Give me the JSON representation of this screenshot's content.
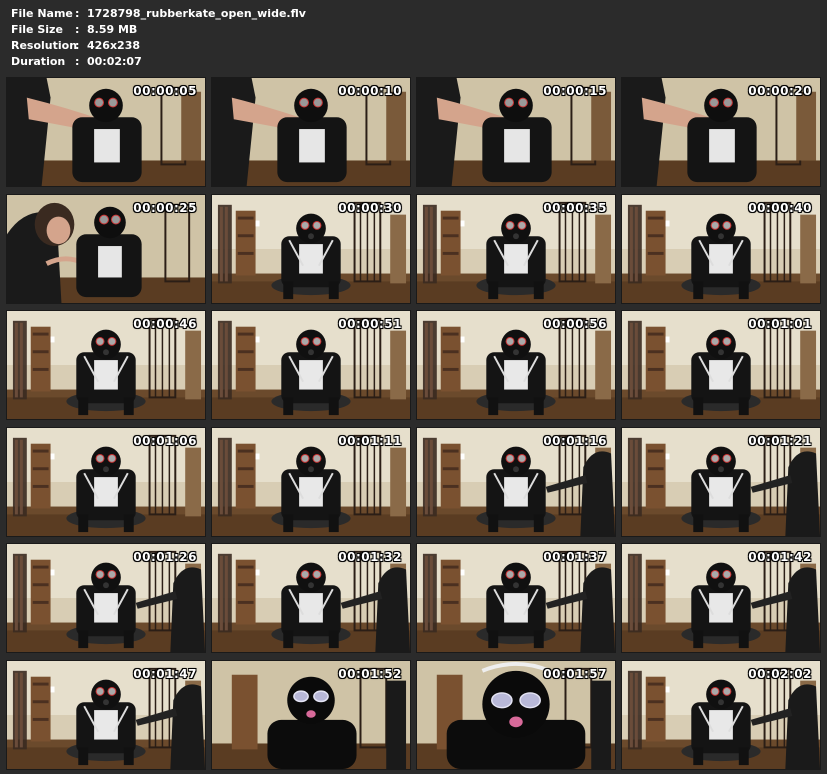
{
  "file_info": {
    "sep": ":",
    "rows": [
      {
        "label": "File Name",
        "value": "1728798_rubberkate_open_wide.flv"
      },
      {
        "label": "File Size",
        "value": "8.59 MB"
      },
      {
        "label": "Resolution",
        "value": "426x238"
      },
      {
        "label": "Duration",
        "value": "00:02:07"
      }
    ]
  },
  "colors": {
    "background": "#2b2b2b",
    "text": "#ffffff"
  },
  "thumbnails": [
    {
      "timestamp": "00:00:05",
      "scene": "closeup-arm"
    },
    {
      "timestamp": "00:00:10",
      "scene": "closeup-arm"
    },
    {
      "timestamp": "00:00:15",
      "scene": "closeup-arm"
    },
    {
      "timestamp": "00:00:20",
      "scene": "closeup-arm"
    },
    {
      "timestamp": "00:00:25",
      "scene": "closeup-face"
    },
    {
      "timestamp": "00:00:30",
      "scene": "room"
    },
    {
      "timestamp": "00:00:35",
      "scene": "room"
    },
    {
      "timestamp": "00:00:40",
      "scene": "room"
    },
    {
      "timestamp": "00:00:46",
      "scene": "room"
    },
    {
      "timestamp": "00:00:51",
      "scene": "room"
    },
    {
      "timestamp": "00:00:56",
      "scene": "room"
    },
    {
      "timestamp": "00:01:01",
      "scene": "room"
    },
    {
      "timestamp": "00:01:06",
      "scene": "room"
    },
    {
      "timestamp": "00:01:11",
      "scene": "room"
    },
    {
      "timestamp": "00:01:16",
      "scene": "room-person"
    },
    {
      "timestamp": "00:01:21",
      "scene": "room-person"
    },
    {
      "timestamp": "00:01:26",
      "scene": "room-person"
    },
    {
      "timestamp": "00:01:32",
      "scene": "room-person"
    },
    {
      "timestamp": "00:01:37",
      "scene": "room-person"
    },
    {
      "timestamp": "00:01:42",
      "scene": "room-person"
    },
    {
      "timestamp": "00:01:47",
      "scene": "room-person"
    },
    {
      "timestamp": "00:01:52",
      "scene": "closeup-mask"
    },
    {
      "timestamp": "00:01:57",
      "scene": "closeup-mask-big"
    },
    {
      "timestamp": "00:02:02",
      "scene": "room-person"
    }
  ]
}
